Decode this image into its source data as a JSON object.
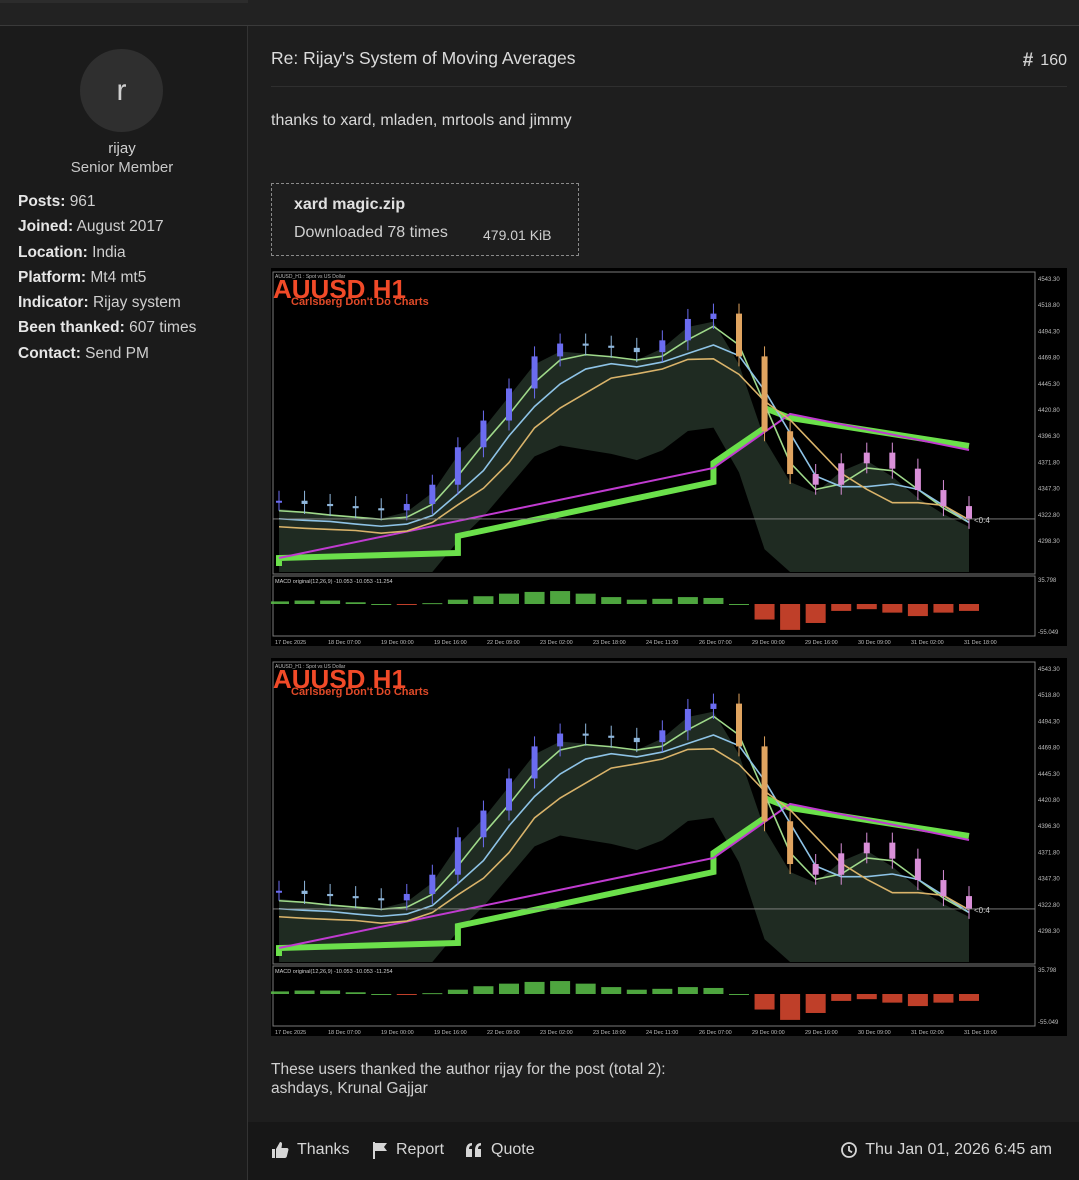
{
  "author": {
    "avatar_letter": "r",
    "username": "rijay",
    "rank": "Senior Member",
    "stats": [
      {
        "label": "Posts:",
        "value": "961"
      },
      {
        "label": "Joined:",
        "value": "August 2017"
      },
      {
        "label": "Location:",
        "value": "India"
      },
      {
        "label": "Platform:",
        "value": "Mt4 mt5"
      },
      {
        "label": "Indicator:",
        "value": "Rijay system"
      },
      {
        "label": "Been thanked:",
        "value": "607 times"
      },
      {
        "label": "Contact:",
        "value": "Send PM"
      }
    ]
  },
  "post": {
    "title": "Re: Rijay's System of Moving Averages",
    "number": "160",
    "body": "thanks to xard, mladen, mrtools and jimmy",
    "attachment": {
      "filename": "xard magic.zip",
      "downloads": "Downloaded 78 times",
      "size": "479.01 KiB"
    },
    "thanks_line1": "These users thanked the author rijay for the post (total 2):",
    "thanks_line2": "ashdays, Krunal Gajjar",
    "actions": {
      "thanks": "Thanks",
      "report": "Report",
      "quote": "Quote"
    },
    "timestamp": "Thu Jan 01, 2026 6:45 am"
  },
  "chart_data": [
    {
      "type": "line",
      "title": "AUUSD H1",
      "subtitle": "Carlsberg Don't Do Charts",
      "header": "AUUSD_H1 : Spot vs US Dollar",
      "current_label": "<0:4",
      "y_ticks": [
        "4543.30",
        "4518.80",
        "4494.30",
        "4469.80",
        "4445.30",
        "4420.80",
        "4396.30",
        "4371.80",
        "4347.30",
        "4322.80",
        "4298.30"
      ],
      "x_ticks": [
        "17 Dec 2025",
        "18 Dec 07:00",
        "19 Dec 00:00",
        "19 Dec 16:00",
        "22 Dec 09:00",
        "23 Dec 02:00",
        "23 Dec 18:00",
        "24 Dec 11:00",
        "26 Dec 07:00",
        "29 Dec 00:00",
        "29 Dec 16:00",
        "30 Dec 09:00",
        "31 Dec 02:00",
        "31 Dec 18:00"
      ],
      "series": [
        {
          "values": [
            4335,
            4332,
            4330,
            4328,
            4326,
            4332,
            4350,
            4385,
            4410,
            4440,
            4470,
            4482,
            4480,
            4478,
            4474,
            4485,
            4505,
            4510,
            4470,
            4400,
            4360,
            4350,
            4370,
            4380,
            4365,
            4345,
            4330,
            4318
          ]
        }
      ],
      "macd_label": "MACD original(12,26,9) -10.053 -10.053 -11.254",
      "macd_ticks": [
        "35.798",
        "-55.049"
      ],
      "macd_values": [
        3,
        4,
        4,
        2,
        0,
        -1,
        1,
        5,
        9,
        12,
        14,
        15,
        12,
        8,
        5,
        6,
        8,
        7,
        0,
        -18,
        -30,
        -22,
        -8,
        -6,
        -10,
        -14,
        -10,
        -8
      ]
    },
    {
      "type": "line",
      "title": "AUUSD H1",
      "subtitle": "Carlsberg Don't Do Charts",
      "header": "AUUSD_H1 : Spot vs US Dollar",
      "current_label": "<0:4",
      "y_ticks": [
        "4543.30",
        "4518.80",
        "4494.30",
        "4469.80",
        "4445.30",
        "4420.80",
        "4396.30",
        "4371.80",
        "4347.30",
        "4322.80",
        "4298.30"
      ],
      "x_ticks": [
        "17 Dec 2025",
        "18 Dec 07:00",
        "19 Dec 00:00",
        "19 Dec 16:00",
        "22 Dec 09:00",
        "23 Dec 02:00",
        "23 Dec 18:00",
        "24 Dec 11:00",
        "26 Dec 07:00",
        "29 Dec 00:00",
        "29 Dec 16:00",
        "30 Dec 09:00",
        "31 Dec 02:00",
        "31 Dec 18:00"
      ],
      "series": [
        {
          "values": [
            4335,
            4332,
            4330,
            4328,
            4326,
            4332,
            4350,
            4385,
            4410,
            4440,
            4470,
            4482,
            4480,
            4478,
            4474,
            4485,
            4505,
            4510,
            4470,
            4400,
            4360,
            4350,
            4370,
            4380,
            4365,
            4345,
            4330,
            4318
          ]
        }
      ],
      "macd_label": "MACD original(12,26,9) -10.053 -10.053 -11.254",
      "macd_ticks": [
        "35.798",
        "-55.049"
      ],
      "macd_values": [
        3,
        4,
        4,
        2,
        0,
        -1,
        1,
        5,
        9,
        12,
        14,
        15,
        12,
        8,
        5,
        6,
        8,
        7,
        0,
        -18,
        -30,
        -22,
        -8,
        -6,
        -10,
        -14,
        -10,
        -8
      ]
    }
  ]
}
